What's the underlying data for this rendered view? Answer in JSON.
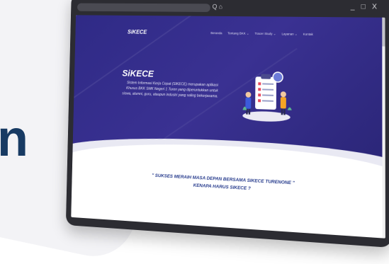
{
  "window": {
    "controls": "_ □ X",
    "toolbar_icons": "Q ⌂"
  },
  "site": {
    "logo": "SiKECE",
    "nav": [
      {
        "label": "Beranda"
      },
      {
        "label": "Tentang BKK ⌄"
      },
      {
        "label": "Tracer Study ⌄"
      },
      {
        "label": "Layanan ⌄"
      },
      {
        "label": "Kontak"
      }
    ],
    "hero_title": "SiKECE",
    "hero_description": "Sistem Informasi Kerja Cepat (SIKECE) merupakan aplikasi Khusus BKK SMK Negeri 1 Turen yang diperuntukkan untuk siswa, alumni, guru, ataupun industri yang saling bekerjasama.",
    "tagline": "\" SUKSES MERAIH MASA DEPAN BERSAMA SIKECE TURENONE \"",
    "subtagline": "KENAPA HARUS SIKECE ?"
  },
  "colors": {
    "hero": "#2f2a86",
    "accent": "#253a8c",
    "frame": "#2c2c32"
  },
  "background_glyph": "n"
}
